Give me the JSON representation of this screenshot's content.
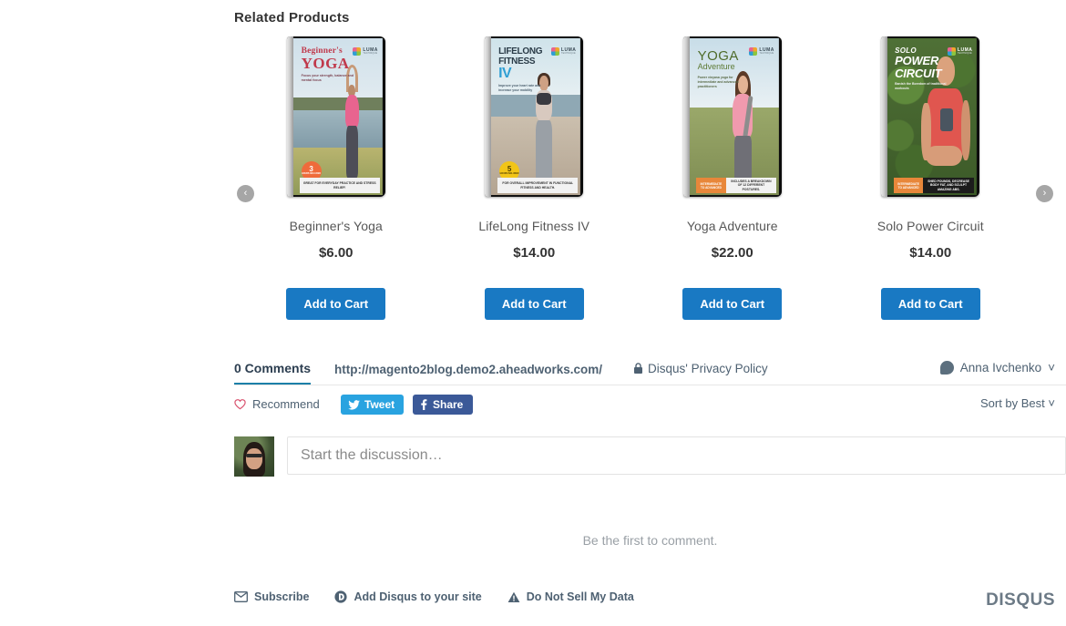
{
  "related": {
    "title": "Related Products",
    "prev_arrow": "‹",
    "next_arrow": "›",
    "products": [
      {
        "name": "Beginner's Yoga",
        "price": "$6.00",
        "add_to_cart": "Add to Cart",
        "cover": {
          "line1": "Beginner's",
          "line2": "YOGA",
          "tagline": "Focus your strength, balance and mental focus",
          "brand_name": "LUMA",
          "brand_sub": "TECHNIQUE",
          "badge_number": "3",
          "badge_caption": "HOURS INCLUDED",
          "badge_color": "#ef6b3b",
          "bottom_tag": "",
          "bottom_blurb": "GREAT FOR EVERYDAY PRACTICE AND STRESS RELIEF!"
        }
      },
      {
        "name": "LifeLong Fitness IV",
        "price": "$14.00",
        "add_to_cart": "Add to Cart",
        "cover": {
          "line1": "LIFELONG FITNESS",
          "line2": "IV",
          "tagline": "Improve your heart rate and increase your mobility",
          "brand_name": "LUMA",
          "brand_sub": "TECHNIQUE",
          "badge_number": "5",
          "badge_caption": "HOURS INCLUDED",
          "badge_color": "#f2c518",
          "bottom_tag": "",
          "bottom_blurb": "FOR OVERALL IMPROVEMENT IN FUNCTIONAL FITNESS AND HEALTH."
        }
      },
      {
        "name": "Yoga Adventure",
        "price": "$22.00",
        "add_to_cart": "Add to Cart",
        "cover": {
          "line1": "YOGA",
          "line2": "Adventure",
          "tagline": "Power vinyasa yoga for intermediate and advanced practitioners",
          "brand_name": "LUMA",
          "brand_sub": "TECHNIQUE",
          "badge_number": "",
          "badge_caption": "",
          "badge_color": "",
          "bottom_tag": "INTERMEDIATE TO ADVANCED",
          "bottom_blurb": "INCLUDES A BREAKDOWN OF 12 DIFFERENT POSTURES."
        }
      },
      {
        "name": "Solo Power Circuit",
        "price": "$14.00",
        "add_to_cart": "Add to Cart",
        "cover": {
          "line1": "SOLO",
          "line2": "POWER CIRCUIT",
          "tagline": "Banish the Boredom of traditional workouts",
          "brand_name": "LUMA",
          "brand_sub": "TECHNIQUE",
          "badge_number": "",
          "badge_caption": "",
          "badge_color": "",
          "bottom_tag": "INTERMEDIATE TO ADVANCED",
          "bottom_blurb": "SHED POUNDS, DECREASE BODY FAT, AND SCULPT AMAZING ABS."
        }
      }
    ]
  },
  "disqus": {
    "comments_tab": "0 Comments",
    "site_url": "http://magento2blog.demo2.aheadworks.com/",
    "privacy_policy": "Disqus' Privacy Policy",
    "username": "Anna Ivchenko",
    "user_caret": "˅",
    "recommend": "Recommend",
    "tweet": "Tweet",
    "share": "Share",
    "sort_by": "Sort by Best",
    "sort_caret": "˅",
    "compose_placeholder": "Start the discussion…",
    "empty_state": "Be the first to comment.",
    "footer_links": [
      {
        "label": "Subscribe",
        "icon": "envelope-icon"
      },
      {
        "label": "Add Disqus to your site",
        "icon": "disqus-d-icon"
      },
      {
        "label": "Do Not Sell My Data",
        "icon": "warning-triangle-icon"
      }
    ],
    "logo": "DISQUS"
  },
  "colors": {
    "button_blue": "#1979c3",
    "tab_underline": "#1b7fa8",
    "tweet_blue": "#29a3e0",
    "facebook_blue": "#3b5998",
    "heart_pink": "#d9536f"
  }
}
